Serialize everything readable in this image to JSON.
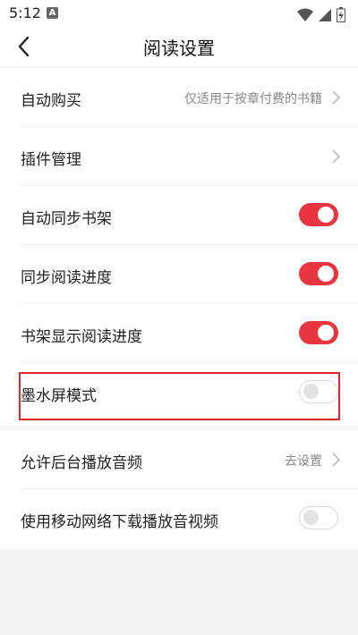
{
  "status": {
    "time": "5:12",
    "a_badge": "A"
  },
  "header": {
    "title": "阅读设置"
  },
  "settings": [
    {
      "label": "自动购买",
      "hint": "仅适用于按章付费的书籍",
      "type": "link"
    },
    {
      "label": "插件管理",
      "hint": "",
      "type": "link"
    },
    {
      "label": "自动同步书架",
      "type": "toggle",
      "value": true
    },
    {
      "label": "同步阅读进度",
      "type": "toggle",
      "value": true
    },
    {
      "label": "书架显示阅读进度",
      "type": "toggle",
      "value": true
    },
    {
      "label": "墨水屏模式",
      "type": "toggle",
      "value": false
    }
  ],
  "settings2": [
    {
      "label": "允许后台播放音频",
      "hint": "去设置",
      "type": "link"
    },
    {
      "label": "使用移动网络下载播放音视频",
      "type": "toggle",
      "value": false
    }
  ],
  "colors": {
    "accent": "#e8353f",
    "highlight": "#e0262e",
    "background": "#f5f5f5"
  }
}
